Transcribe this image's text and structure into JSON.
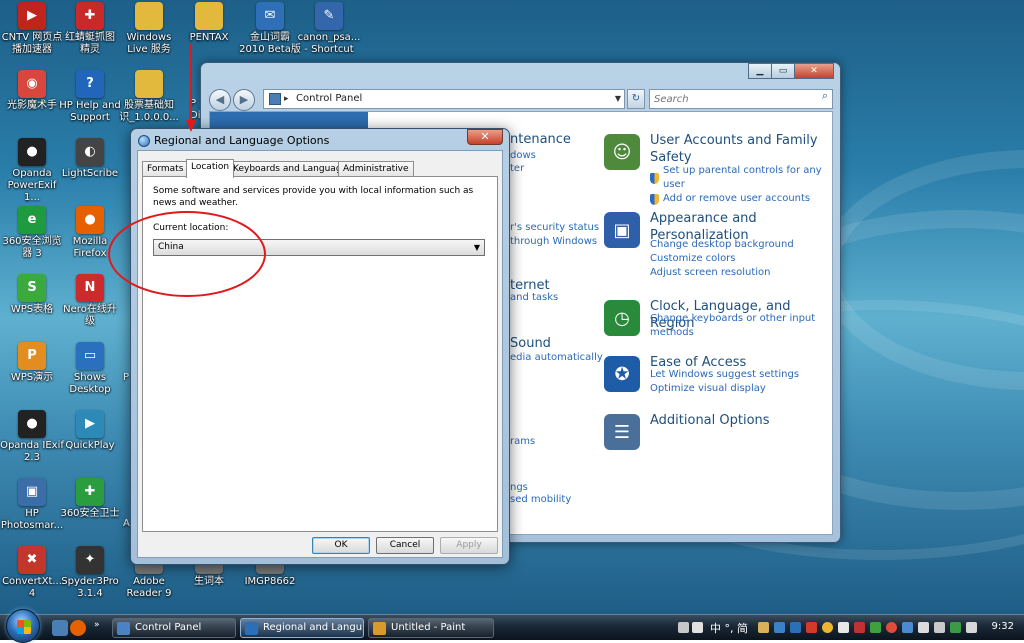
{
  "desktop": {
    "icons": [
      {
        "label": "CNTV 网页点\n播加速器",
        "glyph": "▶",
        "color": "#c0251d"
      },
      {
        "label": "红蜻蜓抓图\n精灵",
        "glyph": "✚",
        "color": "#c82a2a"
      },
      {
        "label": "Windows\nLive 服务",
        "glyph": "",
        "color": "#e2b93c"
      },
      {
        "label": "PENTAX",
        "glyph": "",
        "color": "#e2b93c"
      },
      {
        "label": "金山词霸\n2010 Beta版",
        "glyph": "✉",
        "color": "#2f6fb8"
      },
      {
        "label": "canon_psa...\n- Shortcut",
        "glyph": "✎",
        "color": "#3366aa"
      },
      {
        "label": "光影魔术手",
        "glyph": "◉",
        "color": "#d9463e"
      },
      {
        "label": "HP Help and\nSupport",
        "glyph": "?",
        "color": "#2266bb"
      },
      {
        "label": "股票基础知\n识_1.0.0.0...",
        "glyph": "",
        "color": "#e2b93c"
      },
      {
        "label": "Opanda\nPowerExif 1...",
        "glyph": "●",
        "color": "#222222"
      },
      {
        "label": "LightScribe",
        "glyph": "◐",
        "color": "#444444"
      },
      {
        "label": "360安全浏览\n器 3",
        "glyph": "e",
        "color": "#1e9b3e"
      },
      {
        "label": "Mozilla\nFirefox",
        "glyph": "●",
        "color": "#e66000"
      },
      {
        "label": "WPS表格",
        "glyph": "S",
        "color": "#3aa93e"
      },
      {
        "label": "Nero在线升\n级",
        "glyph": "N",
        "color": "#cc2b2b"
      },
      {
        "label": "WPS演示",
        "glyph": "P",
        "color": "#e28d1f"
      },
      {
        "label": "Shows\nDesktop",
        "glyph": "▭",
        "color": "#2b6fbf"
      },
      {
        "label": "Opanda IExif\n2.3",
        "glyph": "●",
        "color": "#222222"
      },
      {
        "label": "QuickPlay",
        "glyph": "▶",
        "color": "#2d8ab8"
      },
      {
        "label": "HP\nPhotosmar...",
        "glyph": "▣",
        "color": "#3b6ea8"
      },
      {
        "label": "360安全卫士",
        "glyph": "✚",
        "color": "#2a9d3f"
      },
      {
        "label": "ConvertXt...\n4",
        "glyph": "✖",
        "color": "#c2362b"
      },
      {
        "label": "Spyder3Pro\n3.1.4",
        "glyph": "✦",
        "color": "#333333"
      },
      {
        "label": "Adobe\nReader 9",
        "glyph": "",
        "color": "#7a7a7a"
      },
      {
        "label": "生词本",
        "glyph": "",
        "color": "#7a7a7a"
      },
      {
        "label": "IMGP8662",
        "glyph": "",
        "color": "#7a7a7a"
      }
    ],
    "partial_labels": [
      "P",
      "Di",
      "P",
      "A"
    ]
  },
  "control_panel": {
    "address": "Control Panel",
    "search_placeholder": "Search",
    "caption": {
      "minimize": "▁",
      "maximize": "▭",
      "close": "✕"
    },
    "categories": [
      {
        "title": "User Accounts and Family\nSafety",
        "icon": "user-accounts-icon",
        "color": "#4f8a3c",
        "links": [
          {
            "text": "Set up parental controls for any user",
            "shield": true
          },
          {
            "text": "Add or remove user accounts",
            "shield": true
          }
        ]
      },
      {
        "title": "Appearance and\nPersonalization",
        "icon": "appearance-icon",
        "color": "#2f5fa8",
        "links": [
          {
            "text": "Change desktop background",
            "shield": false
          },
          {
            "text": "Customize colors",
            "shield": false
          },
          {
            "text": "Adjust screen resolution",
            "shield": false
          }
        ]
      },
      {
        "title": "Clock, Language, and Region",
        "icon": "globe-clock-icon",
        "color": "#2a8a3c",
        "links": [
          {
            "text": "Change keyboards or other input\nmethods",
            "shield": false
          }
        ]
      },
      {
        "title": "Ease of Access",
        "icon": "ease-of-access-icon",
        "color": "#1f5ca8",
        "links": [
          {
            "text": "Let Windows suggest settings",
            "shield": false
          },
          {
            "text": "Optimize visual display",
            "shield": false
          }
        ]
      },
      {
        "title": "Additional Options",
        "icon": "additional-options-icon",
        "color": "#4a6f99",
        "links": []
      }
    ],
    "hidden_fragments": [
      "ntenance",
      "dows",
      "ter",
      "r's security status",
      "through Windows",
      "ternet",
      "and tasks",
      "Sound",
      "edia automatically",
      "rams",
      "ngs",
      "sed mobility"
    ]
  },
  "dialog": {
    "title": "Regional and Language Options",
    "close": "✕",
    "tabs": [
      "Formats",
      "Location",
      "Keyboards and Languages",
      "Administrative"
    ],
    "active_tab": "Location",
    "description": "Some software and services provide you with local information such as news and weather.",
    "location_label": "Current location:",
    "location_value": "China",
    "buttons": {
      "ok": "OK",
      "cancel": "Cancel",
      "apply": "Apply"
    }
  },
  "annotation_color": "#e01a1a",
  "taskbar": {
    "buttons": [
      {
        "label": "Control Panel",
        "active": false,
        "color": "#4a82c4"
      },
      {
        "label": "Regional and Langu...",
        "active": true,
        "color": "#2b6fb6"
      },
      {
        "label": "Untitled - Paint",
        "active": false,
        "color": "#d89a2a"
      }
    ],
    "ime": "中 °, 简",
    "clock": "9:32"
  }
}
